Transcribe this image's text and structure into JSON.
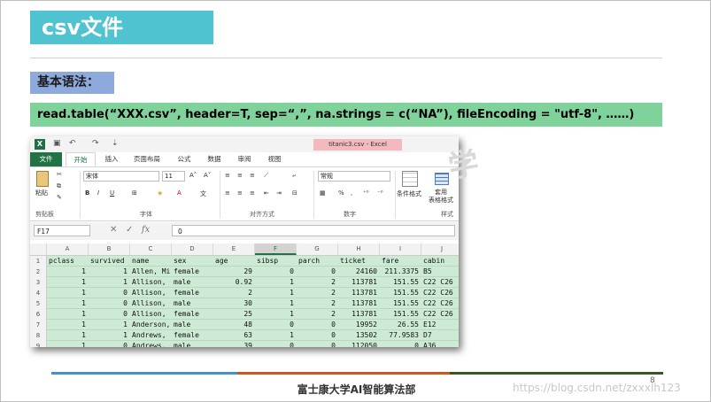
{
  "slide": {
    "title": "csv文件",
    "subtitle": "基本语法：",
    "syntax": "read.table(“XXX.csv”, header=T, sep=“,”, na.strings = c(“NA”), fileEncoding = \"utf-8\", ……)",
    "footer": "富士康大学AI智能算法部",
    "page_number": "8",
    "watermark_url": "https://blog.csdn.net/zxxxlh123",
    "footer_colors": [
      "#4a90c8",
      "#c65a1e",
      "#375623"
    ]
  },
  "excel": {
    "window_title": "titanic3.csv - Excel",
    "tabs": [
      "文件",
      "开始",
      "插入",
      "页面布局",
      "公式",
      "数据",
      "审阅",
      "视图"
    ],
    "active_tab": "开始",
    "ribbon": {
      "paste_label": "粘贴",
      "clipboard_group": "剪贴板",
      "font_name": "宋体",
      "font_size": "11",
      "font_group": "字体",
      "align_group": "对齐方式",
      "number_format": "常规",
      "number_group": "数字",
      "conditional_label": "条件格式",
      "table_format_label": "套用\n表格格式",
      "styles_group": "样式",
      "bold": "B",
      "italic": "I",
      "underline": "U",
      "percent": "%",
      "comma": ","
    },
    "name_box": "F17",
    "formula_value": "0",
    "columns": [
      "A",
      "B",
      "C",
      "D",
      "E",
      "F",
      "G",
      "H",
      "I",
      "J"
    ],
    "selected_column": "F",
    "rows": [
      {
        "n": "1",
        "A": "pclass",
        "B": "survived",
        "C": "name",
        "D": "sex",
        "E": "age",
        "F": "sibsp",
        "G": "parch",
        "H": "ticket",
        "I": "fare",
        "J": "cabin"
      },
      {
        "n": "2",
        "A": "1",
        "B": "1",
        "C": "Allen, Mi",
        "D": "female",
        "E": "29",
        "F": "0",
        "G": "0",
        "H": "24160",
        "I": "211.3375",
        "J": "B5"
      },
      {
        "n": "3",
        "A": "1",
        "B": "1",
        "C": "Allison,",
        "D": "male",
        "E": "0.92",
        "F": "1",
        "G": "2",
        "H": "113781",
        "I": "151.55",
        "J": "C22 C26"
      },
      {
        "n": "4",
        "A": "1",
        "B": "0",
        "C": "Allison,",
        "D": "female",
        "E": "2",
        "F": "1",
        "G": "2",
        "H": "113781",
        "I": "151.55",
        "J": "C22 C26"
      },
      {
        "n": "5",
        "A": "1",
        "B": "0",
        "C": "Allison,",
        "D": "male",
        "E": "30",
        "F": "1",
        "G": "2",
        "H": "113781",
        "I": "151.55",
        "J": "C22 C26"
      },
      {
        "n": "6",
        "A": "1",
        "B": "0",
        "C": "Allison,",
        "D": "female",
        "E": "25",
        "F": "1",
        "G": "2",
        "H": "113781",
        "I": "151.55",
        "J": "C22 C26"
      },
      {
        "n": "7",
        "A": "1",
        "B": "1",
        "C": "Anderson,",
        "D": "male",
        "E": "48",
        "F": "0",
        "G": "0",
        "H": "19952",
        "I": "26.55",
        "J": "E12"
      },
      {
        "n": "8",
        "A": "1",
        "B": "1",
        "C": "Andrews,",
        "D": "female",
        "E": "63",
        "F": "1",
        "G": "0",
        "H": "13502",
        "I": "77.9583",
        "J": "D7"
      },
      {
        "n": "9",
        "A": "1",
        "B": "0",
        "C": "Andrews,",
        "D": "male",
        "E": "39",
        "F": "0",
        "G": "0",
        "H": "112050",
        "I": "0",
        "J": "A36"
      }
    ]
  }
}
